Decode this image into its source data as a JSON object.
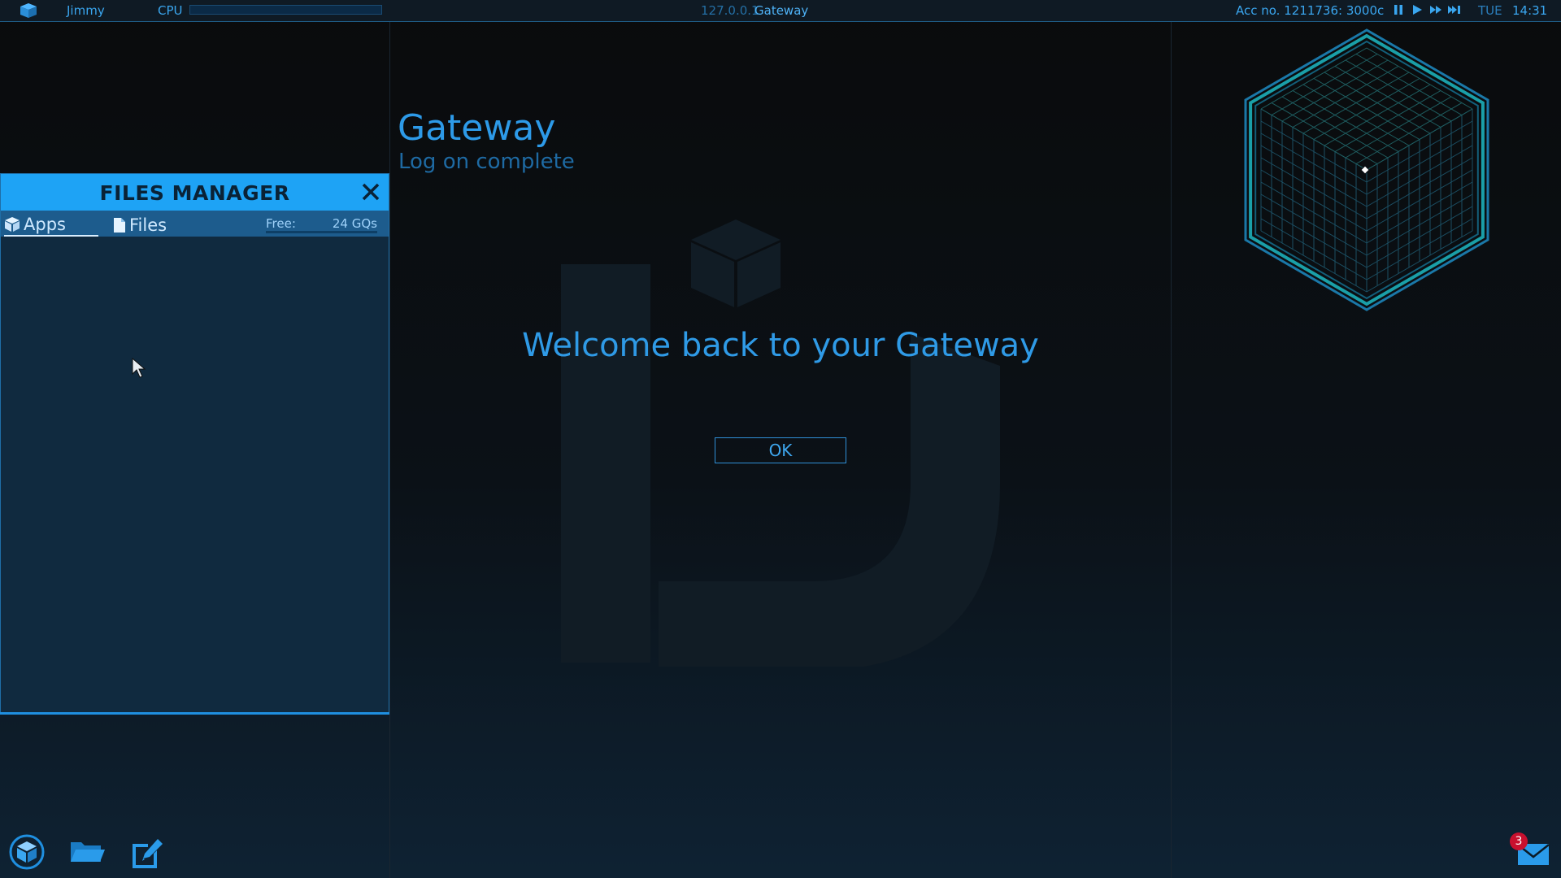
{
  "topbar": {
    "user": "Jimmy",
    "cpu_label": "CPU",
    "cpu_load": 0.0,
    "ip": "127.0.0.1",
    "location": "Gateway",
    "account": "Acc no. 1211736: 3000c",
    "day": "TUE",
    "time": "14:31",
    "speed_controls": [
      "pause-icon",
      "play-icon",
      "fast-forward-icon",
      "fastest-forward-icon"
    ],
    "active_speed": "play-icon"
  },
  "files_manager": {
    "title": "FILES MANAGER",
    "tabs": [
      {
        "label": "Apps",
        "icon": "app-cube-icon",
        "active": true
      },
      {
        "label": "Files",
        "icon": "file-icon",
        "active": false
      }
    ],
    "free_label": "Free:",
    "free_value": "24 GQs"
  },
  "gateway": {
    "title": "Gateway",
    "subtitle": "Log on complete",
    "message": "Welcome back to your Gateway",
    "ok_label": "OK"
  },
  "dock": {
    "icons": [
      "cube-app-icon",
      "folder-icon",
      "notepad-icon"
    ],
    "mail_icon": "mail-icon",
    "mail_count": "3"
  },
  "colors": {
    "accent": "#1ea3f5",
    "text_blue": "#2f9be6",
    "badge": "#c8102e",
    "map_teal": "#1a9fa8"
  }
}
